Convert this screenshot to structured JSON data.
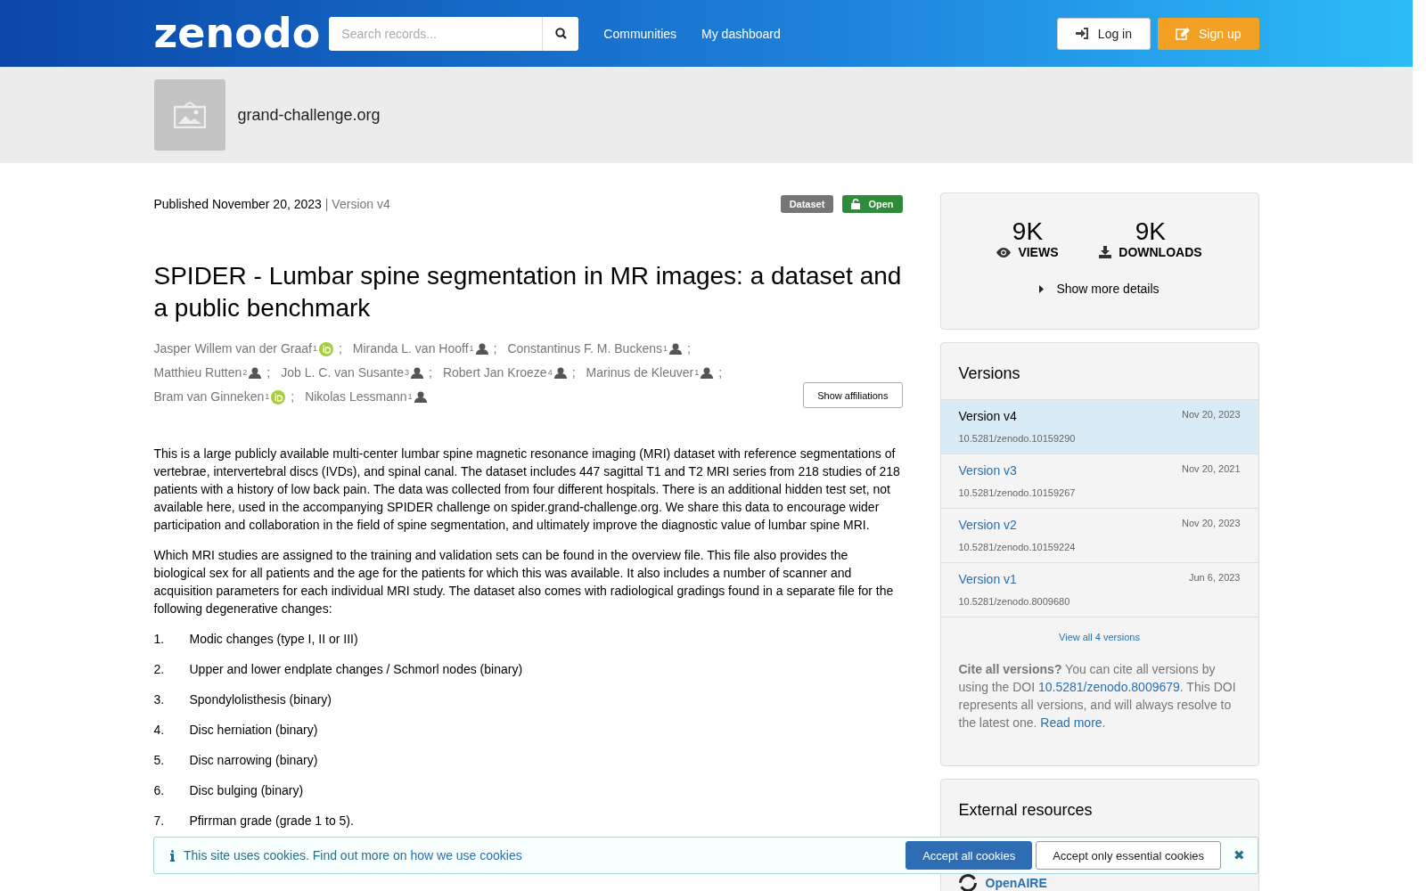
{
  "header": {
    "logo": "zenodo",
    "search": {
      "placeholder": "Search records..."
    },
    "nav": [
      "Communities",
      "My dashboard"
    ],
    "login": "Log in",
    "signup": "Sign up"
  },
  "community": {
    "name": "grand-challenge.org"
  },
  "record": {
    "published": "Published November 20, 2023",
    "version": "| Version v4",
    "badges": [
      {
        "label": "Dataset",
        "kind": "type"
      },
      {
        "label": "Open",
        "kind": "access"
      }
    ],
    "title": "SPIDER - Lumbar spine segmentation in MR images: a dataset and a public benchmark",
    "authors": [
      {
        "name": "Jasper Willem van der Graaf",
        "sup": "1",
        "kind": "orcid",
        "separator": ";"
      },
      {
        "name": "Miranda L. van Hooff",
        "sup": "1",
        "kind": "person",
        "separator": ";"
      },
      {
        "name": "Constantinus F. M. Buckens",
        "sup": "1",
        "kind": "person",
        "separator": ";"
      },
      {
        "name": "Matthieu Rutten",
        "sup": "2",
        "kind": "person",
        "separator": ";"
      },
      {
        "name": "Job L. C. van Susante",
        "sup": "3",
        "kind": "person",
        "separator": ";"
      },
      {
        "name": "Robert Jan Kroeze",
        "sup": "4",
        "kind": "person",
        "separator": ";"
      },
      {
        "name": "Marinus de Kleuver",
        "sup": "1",
        "kind": "person",
        "separator": ";"
      },
      {
        "name": "Bram van Ginneken",
        "sup": "1",
        "kind": "orcid",
        "separator": ";"
      },
      {
        "name": "Nikolas Lessmann",
        "sup": "1",
        "kind": "person"
      }
    ],
    "show_affiliations": "Show affiliations",
    "paragraphs": [
      "This is a large publicly available multi-center lumbar spine magnetic resonance imaging (MRI) dataset with reference segmentations of vertebrae, intervertebral discs (IVDs), and spinal canal. The dataset includes 447 sagittal T1 and T2 MRI series from 218 studies of 218 patients with a history of low back pain. The data was collected from four different hospitals. There is an additional hidden test set, not available here, used in the accompanying SPIDER challenge on spider.grand-challenge.org. We share this data to encourage wider participation and collaboration in the field of spine segmentation, and ultimately improve the diagnostic value of lumbar spine MRI.",
      "Which MRI studies are assigned to the training and validation sets can be found in the overview file. This file also provides the biological sex for all patients and the age for the patients for which this was available. It also includes a number of scanner and acquisition parameters for each individual MRI study. The dataset also comes with radiological gradings found in a separate file for the following degenerative changes:"
    ],
    "list": [
      {
        "number": "1.",
        "text": "Modic changes (type I, II or III)"
      },
      {
        "number": "2.",
        "text": "Upper and lower endplate changes / Schmorl nodes (binary)"
      },
      {
        "number": "3.",
        "text": "Spondylolisthesis (binary)"
      },
      {
        "number": "4.",
        "text": "Disc herniation (binary)"
      },
      {
        "number": "5.",
        "text": "Disc narrowing (binary)"
      },
      {
        "number": "6.",
        "text": "Disc bulging (binary)"
      },
      {
        "number": "7.",
        "text": "Pfirrman grade (grade 1 to 5)."
      }
    ]
  },
  "sidebar": {
    "stats": [
      {
        "value": "9K",
        "label": "VIEWS",
        "kind": "views"
      },
      {
        "value": "9K",
        "label": "DOWNLOADS",
        "kind": "downloads"
      }
    ],
    "show_more": "Show more details",
    "versions": {
      "title": "Versions",
      "items": [
        {
          "label": "Version v4",
          "date": "Nov 20, 2023",
          "doi": "10.5281/zenodo.10159290",
          "selected": true
        },
        {
          "label": "Version v3",
          "date": "Nov 20, 2021",
          "doi": "10.5281/zenodo.10159267",
          "selected": false
        },
        {
          "label": "Version v2",
          "date": "Nov 20, 2023",
          "doi": "10.5281/zenodo.10159224",
          "selected": false
        },
        {
          "label": "Version v1",
          "date": "Jun 6, 2023",
          "doi": "10.5281/zenodo.8009680",
          "selected": false
        }
      ],
      "view_all": "View all 4 versions",
      "cite": {
        "lead": "Cite all versions?",
        "text": " You can cite all versions by using the DOI ",
        "doi": "10.5281/zenodo.8009679",
        "text2": ". This DOI represents all versions, and will always resolve to the latest one. ",
        "read_more": "Read more",
        "end": "."
      }
    },
    "external": {
      "title": "External resources",
      "items": [
        "OpenAIRE"
      ]
    }
  },
  "cookie": {
    "text": "This site uses cookies. Find out more on ",
    "link": "how we use cookies",
    "accept_all": "Accept all cookies",
    "accept_essential": "Accept only essential cookies",
    "close": "✖"
  }
}
